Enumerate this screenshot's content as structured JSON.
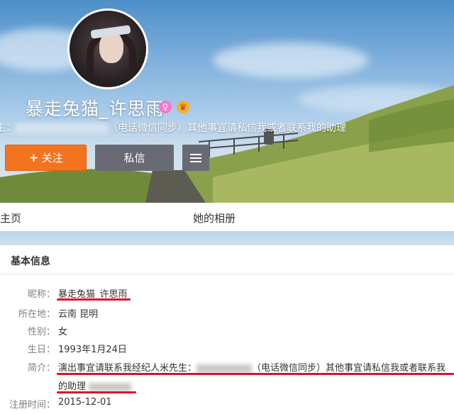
{
  "profile": {
    "name": "暴走兔猫_许思雨",
    "gender_icon": "female-icon",
    "vip_icon": "vip-crown-icon",
    "bio_prefix": "生：",
    "bio_text": "（电话微信同步）其他事宜请私信我或者联系我的助理"
  },
  "actions": {
    "follow_label": "关注",
    "follow_icon": "plus-icon",
    "message_label": "私信",
    "menu_icon": "menu-icon"
  },
  "tabs": {
    "home": "主页",
    "album": "她的相册"
  },
  "info": {
    "title": "基本信息",
    "nickname_label": "昵称：",
    "nickname": "暴走兔猫_许思雨",
    "location_label": "所在地：",
    "location": "云南 昆明",
    "gender_label": "性别：",
    "gender": "女",
    "birthday_label": "生日：",
    "birthday": "1993年1月24日",
    "intro_label": "简介：",
    "intro_line1_a": "演出事宜请联系我经纪人米先生：",
    "intro_line1_b": "（电话微信同步）其他事宜请私信我或者联系我",
    "intro_line2": "的助理",
    "register_label": "注册时间：",
    "register_date": "2015-12-01"
  },
  "colors": {
    "follow_button": "#f3731f",
    "secondary_button": "#6a6a74",
    "annotation_red": "#e0102a"
  }
}
